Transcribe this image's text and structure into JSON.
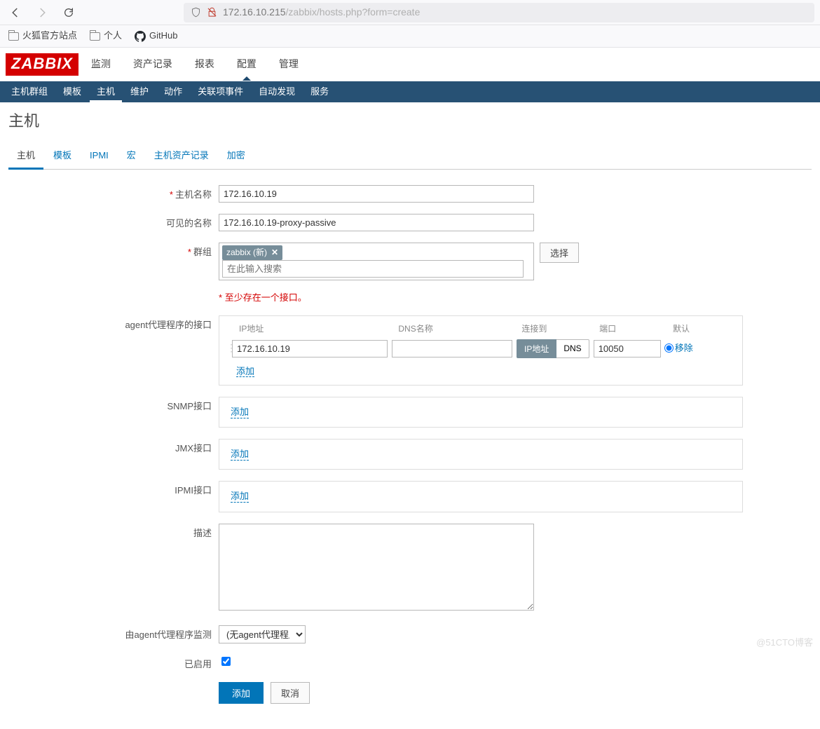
{
  "browser": {
    "url_host": "172.16.10.215",
    "url_path": "/zabbix/hosts.php?form=create",
    "bookmarks": [
      "火狐官方站点",
      "个人",
      "GitHub"
    ]
  },
  "topnav": [
    "监测",
    "资产记录",
    "报表",
    "配置",
    "管理"
  ],
  "topnav_active": 3,
  "subnav": [
    "主机群组",
    "模板",
    "主机",
    "维护",
    "动作",
    "关联项事件",
    "自动发现",
    "服务"
  ],
  "subnav_active": 2,
  "page_title": "主机",
  "tabs": [
    "主机",
    "模板",
    "IPMI",
    "宏",
    "主机资产记录",
    "加密"
  ],
  "tab_active": 0,
  "labels": {
    "host_name": "主机名称",
    "visible_name": "可见的名称",
    "groups": "群组",
    "groups_placeholder": "在此输入搜索",
    "groups_select": "选择",
    "iface_warn": "至少存在一个接口。",
    "agent_iface": "agent代理程序的接口",
    "snmp_iface": "SNMP接口",
    "jmx_iface": "JMX接口",
    "ipmi_iface": "IPMI接口",
    "desc": "描述",
    "monitored_by": "由agent代理程序监测",
    "enabled": "已启用",
    "col_ip": "IP地址",
    "col_dns": "DNS名称",
    "col_use": "连接到",
    "col_port": "端口",
    "col_default": "默认",
    "useip_ip": "IP地址",
    "useip_dns": "DNS",
    "remove": "移除",
    "add": "添加",
    "cancel": "取消"
  },
  "form": {
    "host_name": "172.16.10.19",
    "visible_name": "172.16.10.19-proxy-passive",
    "group_tag": "zabbix (新)",
    "agent_ip": "172.16.10.19",
    "agent_dns": "",
    "agent_port": "10050",
    "proxy_select": "(无agent代理程序)",
    "enabled": true
  },
  "watermark": "@51CTO博客"
}
